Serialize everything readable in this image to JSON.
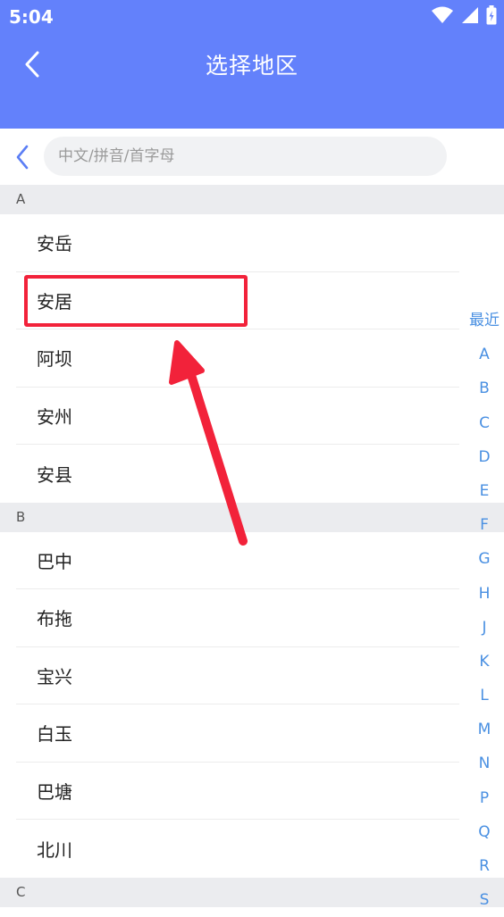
{
  "status_bar": {
    "time": "5:04"
  },
  "header": {
    "title": "选择地区"
  },
  "search": {
    "placeholder": "中文/拼音/首字母",
    "value": ""
  },
  "sections": [
    {
      "letter": "A",
      "cities": [
        "安岳",
        "安居",
        "阿坝",
        "安州",
        "安县"
      ]
    },
    {
      "letter": "B",
      "cities": [
        "巴中",
        "布拖",
        "宝兴",
        "白玉",
        "巴塘",
        "北川"
      ]
    },
    {
      "letter": "C",
      "cities": []
    }
  ],
  "index_bar": [
    "最近",
    "A",
    "B",
    "C",
    "D",
    "E",
    "F",
    "G",
    "H",
    "J",
    "K",
    "L",
    "M",
    "N",
    "P",
    "Q",
    "R",
    "S"
  ],
  "colors": {
    "header": "#6381fb",
    "index": "#4a90e2",
    "annotation": "#f2223a",
    "section_bg": "#ebecef"
  },
  "icons": {
    "status": [
      "wifi-icon",
      "signal-icon",
      "battery-icon"
    ],
    "back": "chevron-left-icon",
    "annotation": "arrow-icon"
  }
}
